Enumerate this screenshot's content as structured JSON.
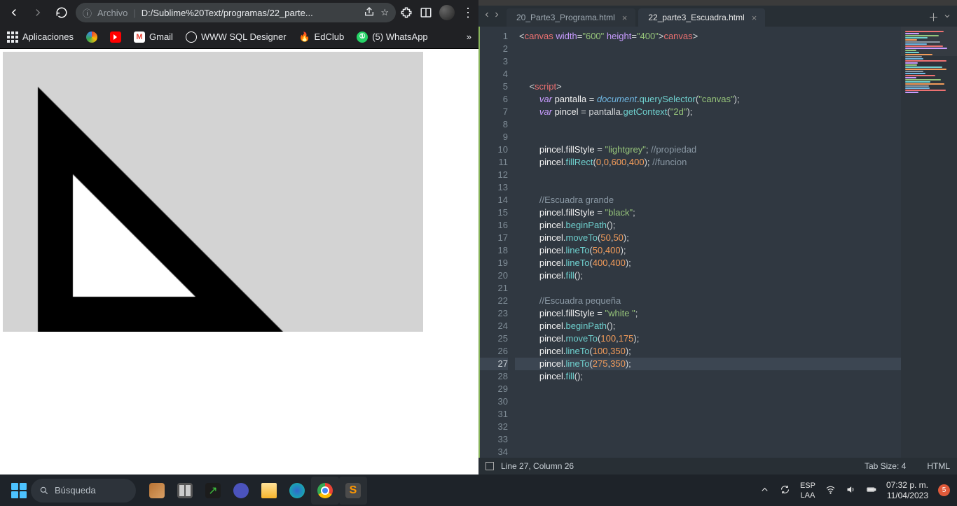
{
  "browser": {
    "address_label": "Archivo",
    "address_path": "D:/Sublime%20Text/programas/22_parte...",
    "info_icon": "ⓘ",
    "bookmarks": {
      "apps": "Aplicaciones",
      "gmail": "Gmail",
      "sql": "WWW SQL Designer",
      "edclub": "EdClub",
      "whatsapp": "(5) WhatsApp"
    }
  },
  "editor": {
    "tabs": {
      "t0": "20_Parte3_Programa.html",
      "t1": "22_parte3_Escuadra.html"
    },
    "code": {
      "l1a": "<",
      "l1b": "canvas",
      "l1c": " width",
      "l1d": "=",
      "l1e": "\"600\"",
      "l1f": " height",
      "l1g": "=",
      "l1h": "\"400\"",
      "l1i": "></",
      "l1j": "canvas",
      "l1k": ">",
      "l5a": "<",
      "l5b": "script",
      "l5c": ">",
      "l6a": "var",
      "l6b": " pantalla ",
      "l6c": "= ",
      "l6d": "document",
      "l6e": ".",
      "l6f": "querySelector",
      "l6g": "(",
      "l6h": "\"canvas\"",
      "l6i": ");",
      "l7a": "var",
      "l7b": " pincel ",
      "l7c": "= pantalla.",
      "l7d": "getContext",
      "l7e": "(",
      "l7f": "\"2d\"",
      "l7g": ");",
      "l10a": "pincel.fillStyle ",
      "l10b": "= ",
      "l10c": "\"lightgrey\"",
      "l10d": "; ",
      "l10e": "//propiedad",
      "l11a": "pincel.",
      "l11b": "fillRect",
      "l11c": "(",
      "l11d": "0",
      "l11e": ",",
      "l11f": "0",
      "l11g": ",",
      "l11h": "600",
      "l11i": ",",
      "l11j": "400",
      "l11k": "); ",
      "l11l": "//funcion",
      "l14": "//Escuadra grande",
      "l15a": "pincel.fillStyle ",
      "l15b": "= ",
      "l15c": "\"black\"",
      "l15d": ";",
      "l16a": "pincel.",
      "l16b": "beginPath",
      "l16c": "();",
      "l17a": "pincel.",
      "l17b": "moveTo",
      "l17c": "(",
      "l17d": "50",
      "l17e": ",",
      "l17f": "50",
      "l17g": ");",
      "l18a": "pincel.",
      "l18b": "lineTo",
      "l18c": "(",
      "l18d": "50",
      "l18e": ",",
      "l18f": "400",
      "l18g": ");",
      "l19a": "pincel.",
      "l19b": "lineTo",
      "l19c": "(",
      "l19d": "400",
      "l19e": ",",
      "l19f": "400",
      "l19g": ");",
      "l20a": "pincel.",
      "l20b": "fill",
      "l20c": "();",
      "l22": "//Escuadra pequeña",
      "l23a": "pincel.fillStyle ",
      "l23b": "= ",
      "l23c": "\"white \"",
      "l23d": ";",
      "l24a": "pincel.",
      "l24b": "beginPath",
      "l24c": "();",
      "l25a": "pincel.",
      "l25b": "moveTo",
      "l25c": "(",
      "l25d": "100",
      "l25e": ",",
      "l25f": "175",
      "l25g": ");",
      "l26a": "pincel.",
      "l26b": "lineTo",
      "l26c": "(",
      "l26d": "100",
      "l26e": ",",
      "l26f": "350",
      "l26g": ");",
      "l27a": "pincel.",
      "l27b": "lineTo",
      "l27c": "(",
      "l27d": "275",
      "l27e": ",",
      "l27f": "350",
      "l27g": ");",
      "l28a": "pincel.",
      "l28b": "fill",
      "l28c": "();"
    },
    "status": {
      "position": "Line 27, Column 26",
      "tabsize": "Tab Size: 4",
      "lang": "HTML"
    },
    "line_numbers": [
      "1",
      "2",
      "3",
      "4",
      "5",
      "6",
      "7",
      "8",
      "9",
      "10",
      "11",
      "12",
      "13",
      "14",
      "15",
      "16",
      "17",
      "18",
      "19",
      "20",
      "21",
      "22",
      "23",
      "24",
      "25",
      "26",
      "27",
      "28",
      "29",
      "30",
      "31",
      "32",
      "33",
      "34"
    ],
    "highlighted_line": 27
  },
  "taskbar": {
    "search_placeholder": "Búsqueda",
    "lang1": "ESP",
    "lang2": "LAA",
    "time": "07:32 p. m.",
    "date": "11/04/2023",
    "notif_count": "5"
  }
}
